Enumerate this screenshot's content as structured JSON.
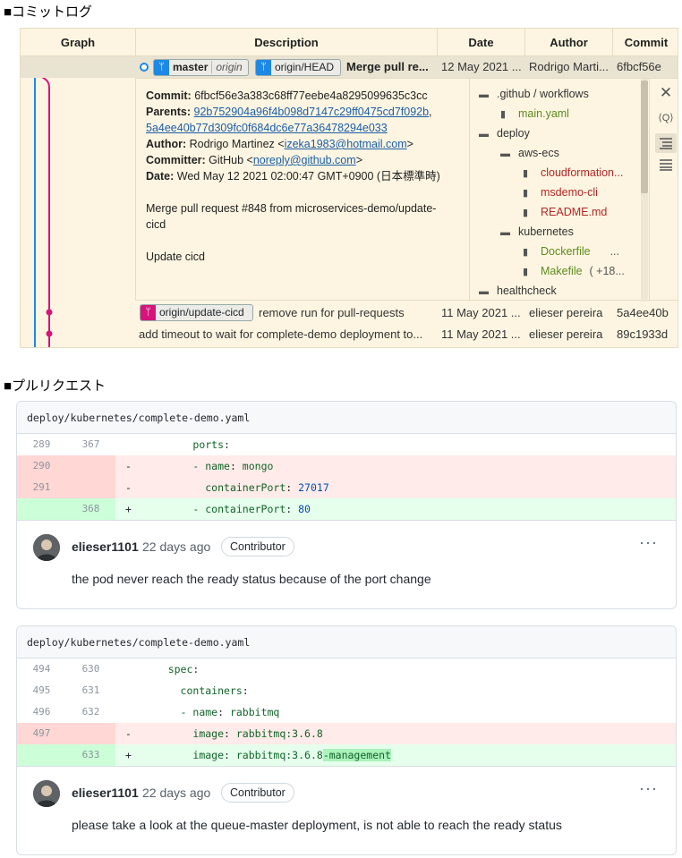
{
  "sections": {
    "commit_log_title": "■コミットログ",
    "pull_request_title": "■プルリクエスト"
  },
  "git_graph": {
    "headers": {
      "graph": "Graph",
      "description": "Description",
      "date": "Date",
      "author": "Author",
      "commit": "Commit"
    },
    "selected_commit": {
      "branch_badge": {
        "name": "master",
        "remote": "origin"
      },
      "remote_badge": "origin/HEAD",
      "message": "Merge pull re...",
      "date": "12 May 2021 ...",
      "author": "Rodrigo Marti...",
      "hash": "6fbcf56e"
    },
    "details": {
      "commit_label": "Commit:",
      "commit_value": "6fbcf56e3a383c68ff77eebe4a8295099635c3cc",
      "parents_label": "Parents:",
      "parent1": "92b752904a96f4b098d7147c29ff0475cd7f092b",
      "parent_sep": ",",
      "parent2": "5a4ee40b77d309fc0f684dc6e77a36478294e033",
      "author_label": "Author:",
      "author_name": "Rodrigo Martinez <",
      "author_email": "izeka1983@hotmail.com",
      "author_close": ">",
      "committer_label": "Committer:",
      "committer_name": "GitHub <",
      "committer_email": "noreply@github.com",
      "committer_close": ">",
      "date_label": "Date:",
      "date_value": "Wed May 12 2021 02:00:47 GMT+0900 (日本標準時)",
      "message_line1": "Merge pull request #848 from microservices-demo/update-",
      "message_line2": "cicd",
      "message_line3": "Update cicd"
    },
    "files": [
      {
        "name": ".github / workflows",
        "kind": "dir"
      },
      {
        "name": "main.yaml",
        "kind": "green"
      },
      {
        "name": "deploy",
        "kind": "dir"
      },
      {
        "name": "aws-ecs",
        "kind": "dir"
      },
      {
        "name": "cloudformation...",
        "kind": "red"
      },
      {
        "name": "msdemo-cli",
        "kind": "red"
      },
      {
        "name": "README.md",
        "kind": "red"
      },
      {
        "name": "kubernetes",
        "kind": "dir"
      },
      {
        "name": "Dockerfile",
        "kind": "green"
      },
      {
        "name": "Makefile",
        "kind": "green"
      },
      {
        "name": "healthcheck",
        "kind": "dir"
      }
    ],
    "file_extras": {
      "dockerfile_more": "...",
      "makefile_more": "( +18..."
    },
    "side_icons": {
      "close": "✕",
      "find": "⟨Q⟩"
    },
    "rows": [
      {
        "badge": "origin/update-cicd",
        "message": "remove run for pull-requests",
        "date": "11 May 2021 ...",
        "author": "elieser pereira",
        "hash": "5a4ee40b"
      },
      {
        "badge": "",
        "message": "add timeout to wait for complete-demo deployment to...",
        "date": "11 May 2021 ...",
        "author": "elieser pereira",
        "hash": "89c1933d"
      }
    ]
  },
  "pull_request": {
    "card1": {
      "path": "deploy/kubernetes/complete-demo.yaml",
      "lines": [
        {
          "type": "ctx",
          "old": "289",
          "new": "367",
          "sign": "",
          "indent": "        ",
          "key": "ports",
          "sep": ":",
          "val": ""
        },
        {
          "type": "del",
          "old": "290",
          "new": "",
          "sign": "-",
          "indent": "        ",
          "key": "- name",
          "sep": ": ",
          "val": "mongo"
        },
        {
          "type": "del",
          "old": "291",
          "new": "",
          "sign": "-",
          "indent": "          ",
          "key": "containerPort",
          "sep": ": ",
          "val": "27017"
        },
        {
          "type": "add",
          "old": "",
          "new": "368",
          "sign": "+",
          "indent": "        ",
          "key": "- containerPort",
          "sep": ": ",
          "val": "80"
        }
      ],
      "comment": {
        "user": "elieser1101",
        "time": "22 days ago",
        "role": "Contributor",
        "more": "···",
        "body": "the pod never reach the ready status because of the port change"
      }
    },
    "card2": {
      "path": "deploy/kubernetes/complete-demo.yaml",
      "lines": [
        {
          "type": "ctx",
          "old": "494",
          "new": "630",
          "sign": "",
          "indent": "    ",
          "key": "spec",
          "sep": ":",
          "val": ""
        },
        {
          "type": "ctx",
          "old": "495",
          "new": "631",
          "sign": "",
          "indent": "      ",
          "key": "containers",
          "sep": ":",
          "val": ""
        },
        {
          "type": "ctx",
          "old": "496",
          "new": "632",
          "sign": "",
          "indent": "      ",
          "key": "- name",
          "sep": ": ",
          "val": "rabbitmq"
        },
        {
          "type": "del",
          "old": "497",
          "new": "",
          "sign": "-",
          "indent": "        ",
          "key": "image",
          "sep": ": ",
          "val": "rabbitmq:3.6.8"
        },
        {
          "type": "add",
          "old": "",
          "new": "633",
          "sign": "+",
          "indent": "        ",
          "key": "image",
          "sep": ": ",
          "val": "rabbitmq:3.6.8",
          "val_hl": "-management"
        }
      ],
      "comment": {
        "user": "elieser1101",
        "time": "22 days ago",
        "role": "Contributor",
        "more": "···",
        "body": "please take a look at the queue-master deployment, is not able to reach the ready status"
      }
    }
  },
  "colors": {
    "graph_blue": "#1e88e5",
    "graph_pink": "#d6147c",
    "panel_bg": "#fdf5e1",
    "diff_del": "#ffebe9",
    "diff_add": "#e6ffec"
  }
}
